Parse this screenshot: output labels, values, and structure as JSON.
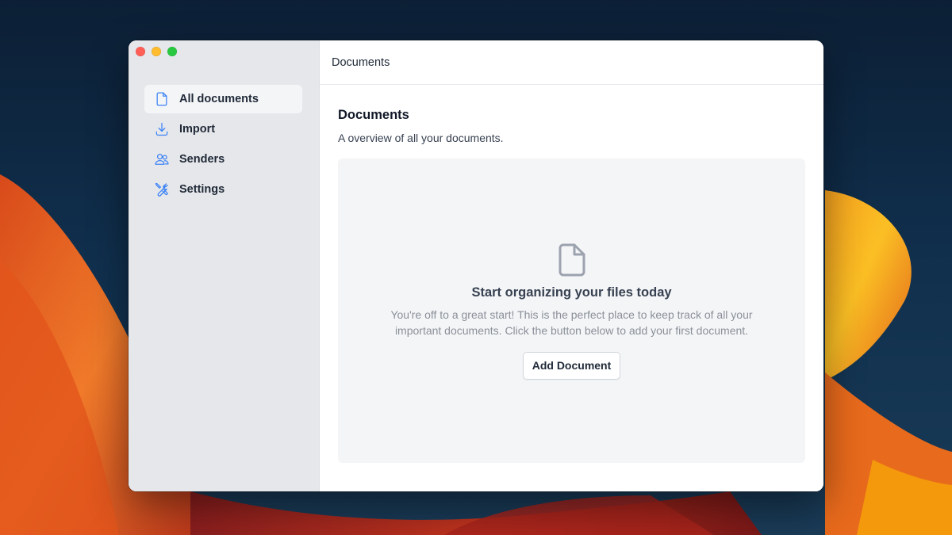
{
  "colors": {
    "accent": "#3b82f6",
    "sidebar_bg": "#e6e7ea",
    "empty_bg": "#f4f5f7"
  },
  "window": {
    "controls": [
      "close",
      "minimize",
      "zoom"
    ]
  },
  "sidebar": {
    "items": [
      {
        "label": "All documents",
        "icon": "document-icon",
        "active": true
      },
      {
        "label": "Import",
        "icon": "download-icon",
        "active": false
      },
      {
        "label": "Senders",
        "icon": "users-icon",
        "active": false
      },
      {
        "label": "Settings",
        "icon": "wrench-screwdriver-icon",
        "active": false
      }
    ]
  },
  "header": {
    "title": "Documents"
  },
  "main": {
    "title": "Documents",
    "subtitle": "A overview of all your documents.",
    "empty_state": {
      "icon": "document-icon",
      "title": "Start organizing your files today",
      "text": "You're off to a great start! This is the perfect place to keep track of all your important documents. Click the button below to add your first document.",
      "button_label": "Add Document"
    }
  }
}
